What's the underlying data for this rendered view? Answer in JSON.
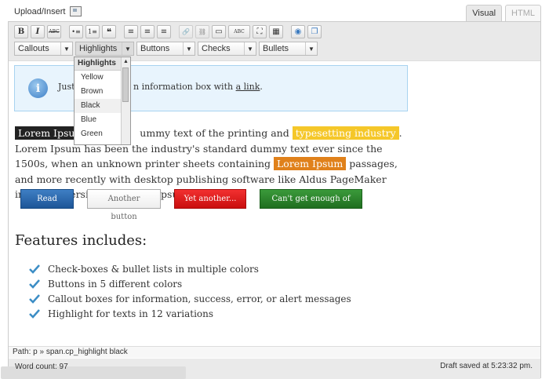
{
  "header": {
    "upload_label": "Upload/Insert",
    "tabs": [
      {
        "label": "Visual",
        "active": true
      },
      {
        "label": "HTML",
        "active": false
      }
    ]
  },
  "toolbar": {
    "row1": [
      {
        "name": "bold-button",
        "glyph": "B"
      },
      {
        "name": "italic-button",
        "glyph": "I"
      },
      {
        "name": "strikethrough-button",
        "glyph": "ABC"
      },
      {
        "name": "bullet-list-button",
        "glyph": "•≡"
      },
      {
        "name": "numbered-list-button",
        "glyph": "1≡"
      },
      {
        "name": "blockquote-button",
        "glyph": "❝"
      },
      {
        "name": "align-left-button",
        "glyph": "≡"
      },
      {
        "name": "align-center-button",
        "glyph": "≡"
      },
      {
        "name": "align-right-button",
        "glyph": "≡"
      },
      {
        "name": "insert-link-button",
        "glyph": "🔗"
      },
      {
        "name": "unlink-button",
        "glyph": "⛓"
      },
      {
        "name": "insert-more-button",
        "glyph": "▭"
      },
      {
        "name": "spellcheck-button",
        "glyph": "ABC"
      },
      {
        "name": "fullscreen-button",
        "glyph": "⛶"
      },
      {
        "name": "kitchen-sink-button",
        "glyph": "▦"
      },
      {
        "name": "insert-media-button",
        "glyph": "◉"
      },
      {
        "name": "paste-button",
        "glyph": "❐"
      }
    ],
    "dropdowns": [
      {
        "label": "Callouts",
        "open": false
      },
      {
        "label": "Highlights",
        "open": true
      },
      {
        "label": "Buttons",
        "open": false
      },
      {
        "label": "Checks",
        "open": false
      },
      {
        "label": "Bullets",
        "open": false
      }
    ]
  },
  "highlights_menu": {
    "header": "Highlights",
    "items": [
      "Yellow",
      "Brown",
      "Black",
      "Blue",
      "Green"
    ],
    "hovered": "Black"
  },
  "callout": {
    "text_before": "Just te",
    "text_middle": "n information box with ",
    "link_text": "a link",
    "text_after": "."
  },
  "paragraph": {
    "hl_black": "Lorem Ipsum",
    "t1": "ummy text of the printing and ",
    "hl_yellow": "typesetting industry",
    "t2": ". Lorem Ipsum has been the industry's standard dummy text ever since the 1500s, when an unknown printer sheets containing ",
    "hl_orange": "Lorem Ipsum",
    "t3": " passages, and more recently with desktop publishing software like Aldus PageMaker including versions of Lorem Ipsum."
  },
  "buttons": {
    "blue": "Read More",
    "white": "Another button",
    "red": "Yet another...",
    "green": "Can't get enough of this!"
  },
  "features": {
    "title": "Features includes:",
    "items": [
      "Check-boxes & bullet lists in multiple colors",
      "Buttons in 5 different colors",
      "Callout boxes for information, success, error, or alert messages",
      "Highlight for texts in 12 variations"
    ],
    "check_color": "#3c8dc5"
  },
  "status": {
    "path_label": "Path:",
    "path_p": "p",
    "path_sep": "»",
    "path_span": "span.cp_highlight black",
    "word_count": "Word count: 97",
    "draft": "Draft saved at 5:23:32 pm."
  }
}
